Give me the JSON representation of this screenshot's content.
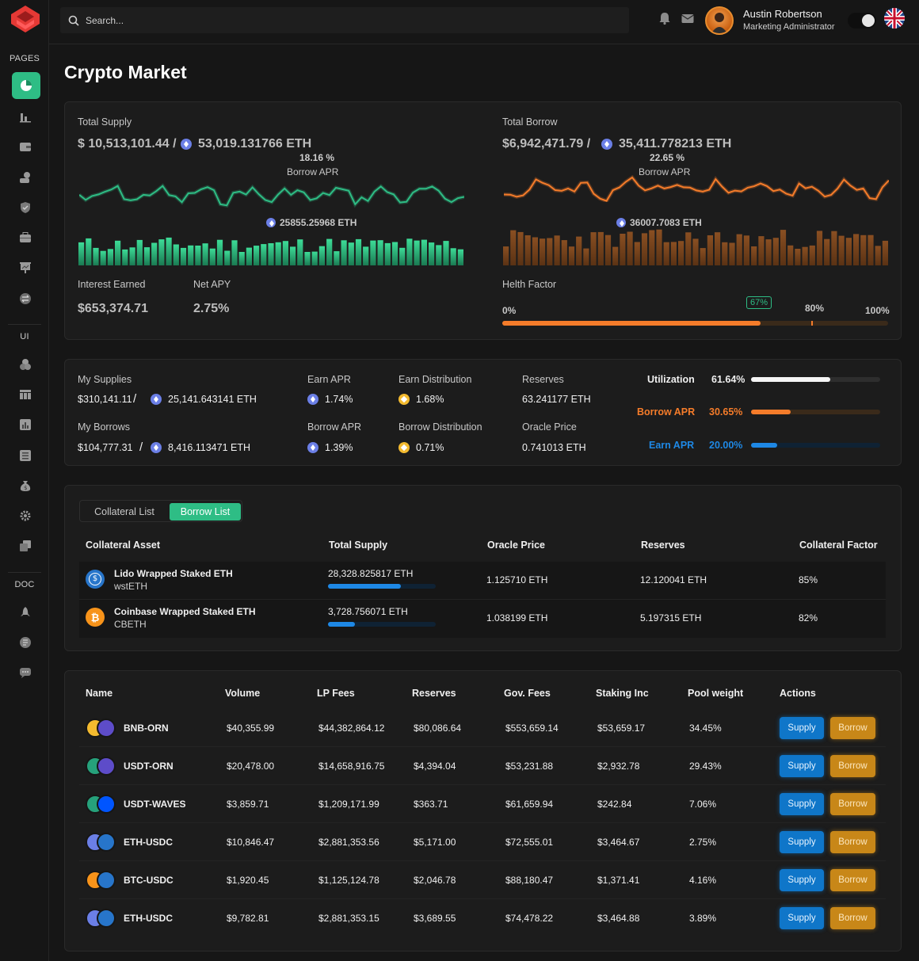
{
  "app": {
    "accent": "#2ebd85",
    "bg": "#161616"
  },
  "header": {
    "search_placeholder": "Search...",
    "user_name": "Austin Robertson",
    "user_role": "Marketing Administrator"
  },
  "sidebar": {
    "sections": [
      "PAGES",
      "UI",
      "DOC"
    ]
  },
  "page_title": "Crypto Market",
  "supply": {
    "label": "Total Supply",
    "usd": "$ 10,513,101.44 /",
    "eth": "53,019.131766 ETH",
    "apr_value": "18.16 %",
    "apr_label": "Borrow APR",
    "bar_eth": "25855.25968 ETH",
    "interest_label": "Interest Earned",
    "interest_value": "$653,374.71",
    "apy_label": "Net APY",
    "apy_value": "2.75%"
  },
  "borrow": {
    "label": "Total Borrow",
    "usd": "$6,942,471.79 /",
    "eth": "35,411.778213 ETH",
    "apr_value": "22.65 %",
    "apr_label": "Borrow APR",
    "bar_eth": "36007.7083 ETH",
    "health_label": "Helth Factor",
    "health_badge": "67%",
    "health_0": "0%",
    "health_80": "80%",
    "health_100": "100%",
    "health_level": 0.67
  },
  "position": {
    "my_supplies_label": "My Supplies",
    "my_supplies_usd": "$310,141.11",
    "my_supplies_eth": "25,141.643141 ETH",
    "my_borrows_label": "My Borrows",
    "my_borrows_usd": "$104,777.31",
    "my_borrows_eth": "8,416.113471 ETH",
    "slash": "/",
    "earn_apr_label": "Earn APR",
    "earn_apr_value": "1.74%",
    "borrow_apr_label": "Borrow APR",
    "borrow_apr_value": "1.39%",
    "earn_dist_label": "Earn Distribution",
    "earn_dist_value": "1.68%",
    "borrow_dist_label": "Borrow Distribution",
    "borrow_dist_value": "0.71%",
    "reserves_label": "Reserves",
    "reserves_value": "63.241177 ETH",
    "oracle_label": "Oracle Price",
    "oracle_value": "0.741013 ETH",
    "util_label": "Utilization",
    "util_value": "61.64%",
    "util_level": 0.6164,
    "bapr_label": "Borrow APR",
    "bapr_value": "30.65%",
    "bapr_level": 0.3065,
    "eapr_label": "Earn APR",
    "eapr_value": "20.00%",
    "eapr_level": 0.2
  },
  "collateral": {
    "tabs": [
      "Collateral List",
      "Borrow List"
    ],
    "headers": [
      "Collateral Asset",
      "Total Supply",
      "Oracle Price",
      "Reserves",
      "Collateral Factor"
    ],
    "rows": [
      {
        "name": "Lido Wrapped Staked ETH",
        "symbol": "wstETH",
        "supply": "28,328.825817 ETH",
        "supply_level": 0.68,
        "oracle": "1.125710 ETH",
        "reserves": "12.120041 ETH",
        "factor": "85%"
      },
      {
        "name": "Coinbase Wrapped Staked ETH",
        "symbol": "CBETH",
        "supply": "3,728.756071 ETH",
        "supply_level": 0.25,
        "oracle": "1.038199 ETH",
        "reserves": "5.197315 ETH",
        "factor": "82%"
      }
    ]
  },
  "pools": {
    "headers": [
      "Name",
      "Volume",
      "LP Fees",
      "Reserves",
      "Gov. Fees",
      "Staking Inc",
      "Pool weight",
      "Actions"
    ],
    "supply_label": "Supply",
    "borrow_label": "Borrow",
    "rows": [
      {
        "name": "BNB-ORN",
        "volume": "$40,355.99",
        "lp": "$44,382,864.12",
        "reserves": "$80,086.64",
        "gov": "$553,659.14",
        "staking": "$53,659.17",
        "weight": "34.45%"
      },
      {
        "name": "USDT-ORN",
        "volume": "$20,478.00",
        "lp": "$14,658,916.75",
        "reserves": "$4,394.04",
        "gov": "$53,231.88",
        "staking": "$2,932.78",
        "weight": "29.43%"
      },
      {
        "name": "USDT-WAVES",
        "volume": "$3,859.71",
        "lp": "$1,209,171.99",
        "reserves": "$363.71",
        "gov": "$61,659.94",
        "staking": "$242.84",
        "weight": "7.06%"
      },
      {
        "name": "ETH-USDC",
        "volume": "$10,846.47",
        "lp": "$2,881,353.56",
        "reserves": "$5,171.00",
        "gov": "$72,555.01",
        "staking": "$3,464.67",
        "weight": "2.75%"
      },
      {
        "name": "BTC-USDC",
        "volume": "$1,920.45",
        "lp": "$1,125,124.78",
        "reserves": "$2,046.78",
        "gov": "$88,180.47",
        "staking": "$1,371.41",
        "weight": "4.16%"
      },
      {
        "name": "ETH-USDC",
        "volume": "$9,782.81",
        "lp": "$2,881,353.15",
        "reserves": "$3,689.55",
        "gov": "$74,478.22",
        "staking": "$3,464.88",
        "weight": "3.89%"
      }
    ]
  }
}
